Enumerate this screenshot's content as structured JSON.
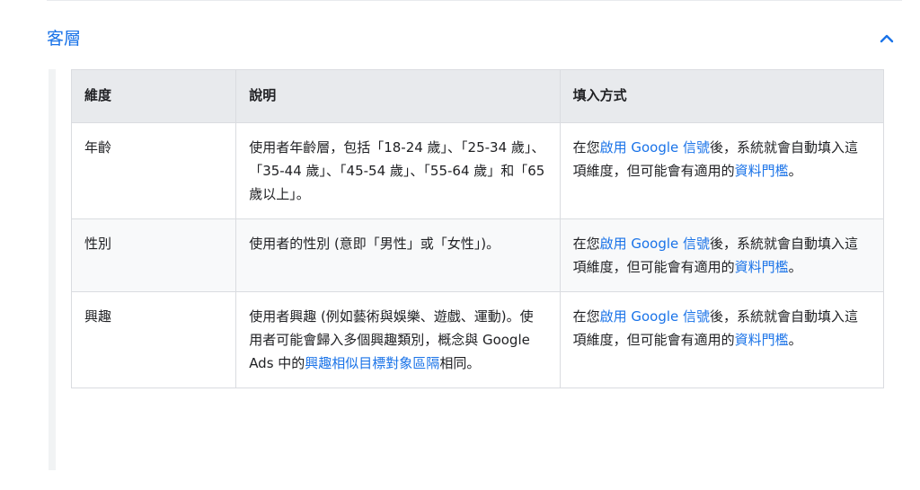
{
  "section": {
    "title": "客層",
    "toggle_icon": "chevron-up-icon"
  },
  "table": {
    "headers": [
      "維度",
      "說明",
      "填入方式"
    ],
    "rows": [
      {
        "dimension": "年齡",
        "description": "使用者年齡層，包括「18-24 歲」、「25-34 歲」、「35-44 歲」、「45-54 歲」、「55-64 歲」和「65 歲以上」。",
        "fill_before": "在您",
        "fill_link1": "啟用 Google 信號",
        "fill_middle": "後，系統就會自動填入這項維度，但可能會有適用的",
        "fill_link2": "資料門檻",
        "fill_after": "。"
      },
      {
        "dimension": "性別",
        "description": "使用者的性別 (意即「男性」或「女性」)。",
        "fill_before": "在您",
        "fill_link1": "啟用 Google 信號",
        "fill_middle": "後，系統就會自動填入這項維度，但可能會有適用的",
        "fill_link2": "資料門檻",
        "fill_after": "。"
      },
      {
        "dimension": "興趣",
        "description_before": "使用者興趣 (例如藝術與娛樂、遊戲、運動)。使用者可能會歸入多個興趣類別，概念與 Google Ads 中的",
        "description_link": "興趣相似目標對象區隔",
        "description_after": "相同。",
        "fill_before": "在您",
        "fill_link1": "啟用 Google 信號",
        "fill_middle": "後，系統就會自動填入這項維度，但可能會有適用的",
        "fill_link2": "資料門檻",
        "fill_after": "。"
      }
    ]
  },
  "colors": {
    "link": "#1a73e8",
    "header_bg": "#e8eaed",
    "border": "#dadce0"
  }
}
